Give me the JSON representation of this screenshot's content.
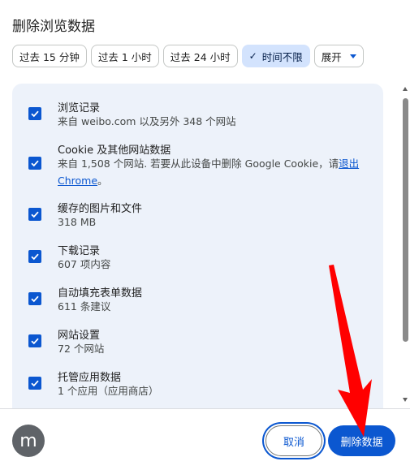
{
  "dialog": {
    "title": "删除浏览数据"
  },
  "time_chips": [
    {
      "label": "过去 15 分钟",
      "selected": false
    },
    {
      "label": "过去 1 小时",
      "selected": false
    },
    {
      "label": "过去 24 小时",
      "selected": false
    },
    {
      "label": "时间不限",
      "selected": true
    }
  ],
  "expand_chip": {
    "label": "展开"
  },
  "items": [
    {
      "title": "浏览记录",
      "desc": "来自 weibo.com 以及另外 348 个网站",
      "checked": true
    },
    {
      "title": "Cookie 及其他网站数据",
      "desc_prefix": "来自 1,508 个网站. 若要从此设备中删除 Google Cookie，请",
      "desc_link": "退出 Chrome",
      "desc_suffix": "。",
      "checked": true
    },
    {
      "title": "缓存的图片和文件",
      "desc": "318 MB",
      "checked": true
    },
    {
      "title": "下载记录",
      "desc": "607 项内容",
      "checked": true
    },
    {
      "title": "自动填充表单数据",
      "desc": "611 条建议",
      "checked": true
    },
    {
      "title": "网站设置",
      "desc": "72 个网站",
      "checked": true
    },
    {
      "title": "托管应用数据",
      "desc": "1 个应用（应用商店）",
      "checked": true
    }
  ],
  "footer": {
    "avatar_letter": "m",
    "cancel_label": "取消",
    "delete_label": "删除数据"
  },
  "colors": {
    "accent": "#0b57d0",
    "panel": "#edf2fa",
    "selected_chip": "#d3e3fd",
    "arrow": "#ff0000"
  },
  "icons": {
    "check": "check-icon",
    "caret": "chevron-down-icon"
  }
}
